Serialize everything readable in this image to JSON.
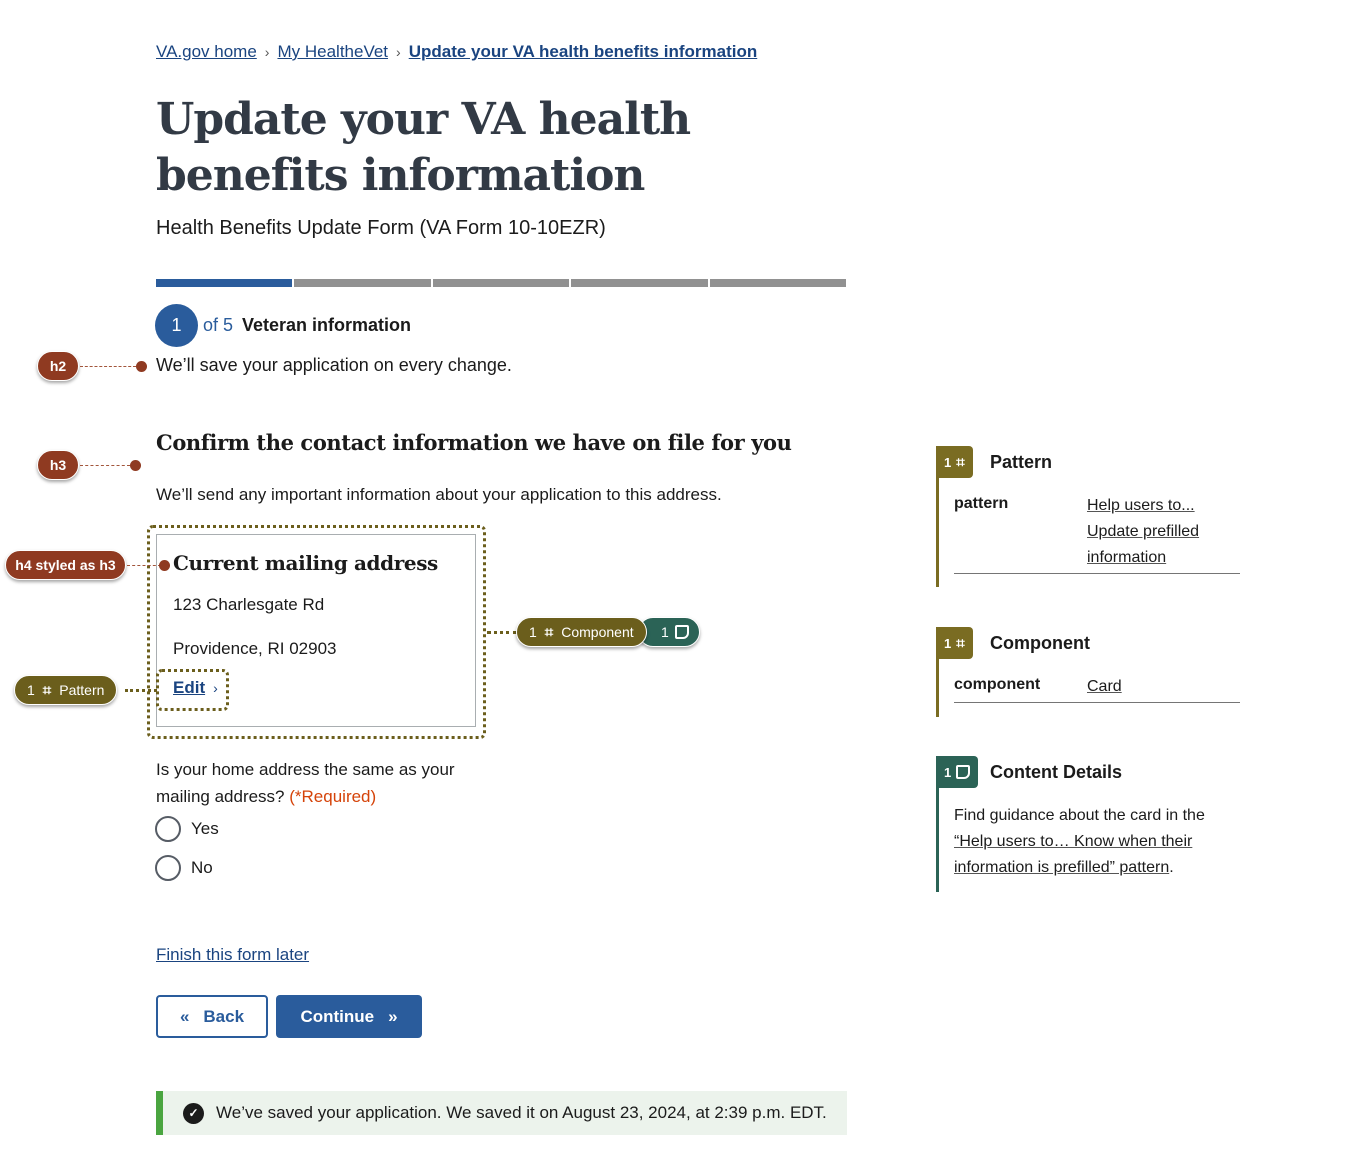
{
  "breadcrumb": {
    "items": [
      "VA.gov home",
      "My HealtheVet"
    ],
    "current": "Update your VA health benefits information",
    "separator": "›"
  },
  "page": {
    "title": "Update your VA health benefits information",
    "subtitle": "Health Benefits Update Form (VA Form 10-10EZR)"
  },
  "progress": {
    "current_step": 1,
    "total_steps": 5,
    "step_number": "1",
    "of_label": "of 5",
    "step_name": "Veteran information",
    "save_note": "We’ll save your application on every change."
  },
  "section": {
    "heading": "Confirm the contact information we have on file for you",
    "description": "We’ll send any important information about your application to this address."
  },
  "card": {
    "title": "Current mailing address",
    "address_line1": "123 Charlesgate Rd",
    "address_line2": "Providence, RI 02903",
    "edit_label": "Edit",
    "edit_chevron": "›"
  },
  "question": {
    "label": "Is your home address the same as your mailing address?",
    "required": "(*Required)",
    "options": [
      "Yes",
      "No"
    ]
  },
  "finish_later": "Finish this form later",
  "buttons": {
    "back": "Back",
    "back_icon": "«",
    "continue": "Continue",
    "continue_icon": "»"
  },
  "alert": {
    "icon": "✓",
    "message": "We’ve saved your application. We saved it on August 23, 2024, at 2:39 p.m. EDT."
  },
  "annotations": {
    "h2": "h2",
    "h3": "h3",
    "h4": "h4 styled as h3",
    "pattern_pill": {
      "count": "1",
      "icon": "⌗",
      "label": "Pattern"
    },
    "component_pill": {
      "count": "1",
      "icon": "⌗",
      "label": "Component"
    },
    "note_pill": {
      "count": "1"
    }
  },
  "panels": {
    "pattern": {
      "count": "1",
      "title": "Pattern",
      "key": "pattern",
      "value_lines": [
        "Help users to...",
        "Update prefilled",
        "information"
      ]
    },
    "component": {
      "count": "1",
      "title": "Component",
      "key": "component",
      "value": "Card"
    },
    "content_details": {
      "count": "1",
      "title": "Content Details",
      "text_before": "Find guidance about the card in the",
      "link_line1": "“Help users to… Know when their",
      "link_line2": "information is prefilled” pattern",
      "text_after": "."
    }
  },
  "colors": {
    "primary": "#2a5c9c",
    "link": "#1a4480",
    "heading_annotation": "#8f3a21",
    "pattern_annotation": "#6b5e1c",
    "content_annotation": "#2b6356",
    "required": "#d54309",
    "success": "#4aa540"
  }
}
